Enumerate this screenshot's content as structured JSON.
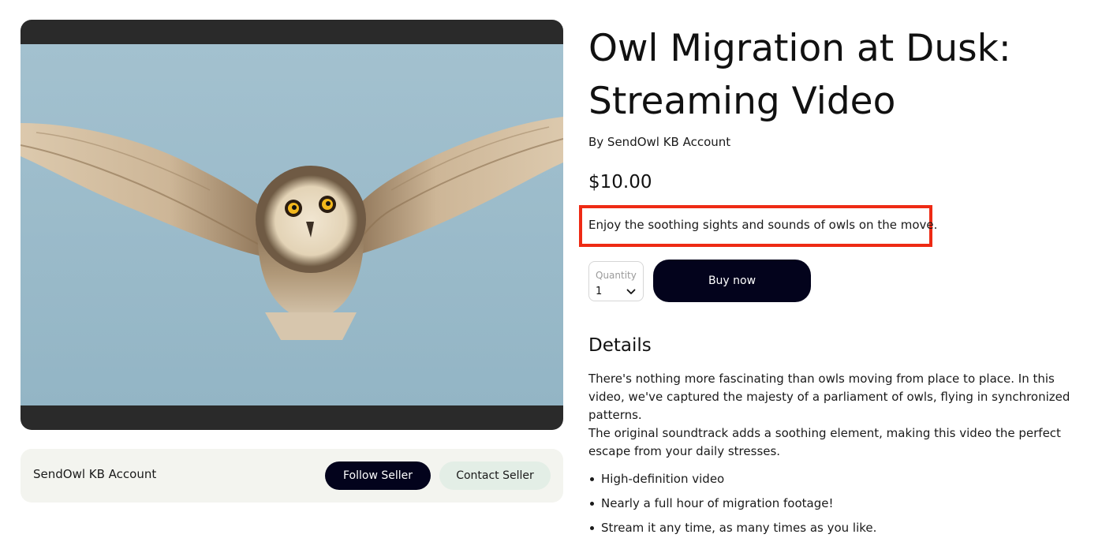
{
  "product": {
    "title": "Owl Migration at Dusk: Streaming Video",
    "author": "By SendOwl KB Account",
    "price": "$10.00",
    "tagline": "Enjoy the soothing sights and sounds of owls on the move."
  },
  "purchase": {
    "quantity_label": "Quantity",
    "quantity_value": "1",
    "buy_label": "Buy now"
  },
  "seller": {
    "name": "SendOwl KB Account",
    "follow_label": "Follow Seller",
    "contact_label": "Contact Seller"
  },
  "details": {
    "heading": "Details",
    "paragraphs": [
      "There's nothing more fascinating than owls moving from place to place. In this video, we've captured the majesty of a parliament of owls, flying in synchronized patterns.",
      "The original soundtrack adds a soothing element, making this video the perfect escape from your daily stresses."
    ],
    "bullets": [
      "High-definition video",
      "Nearly a full hour of migration footage!",
      "Stream it any time, as many times as you like."
    ]
  },
  "colors": {
    "primary_button": "#03031c",
    "secondary_button": "#e3eee6",
    "highlight_box": "#ee2a14",
    "seller_card": "#f3f4ef",
    "video_frame": "#2a2a2a",
    "sky": "#9cbccb"
  },
  "icons": {
    "quantity_dropdown": "chevron-down-icon"
  }
}
